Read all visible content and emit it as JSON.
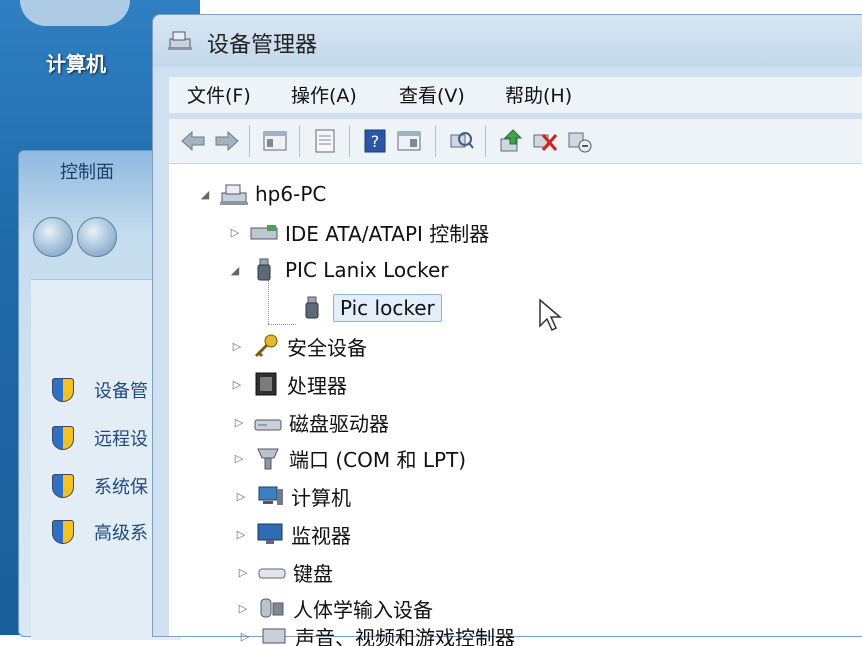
{
  "desktop": {
    "computer_label": "计算机",
    "control_panel": {
      "home_label": "控制面",
      "links": [
        "设备管",
        "远程设",
        "系统保",
        "高级系"
      ]
    }
  },
  "window": {
    "title": "设备管理器",
    "menu": [
      "文件(F)",
      "操作(A)",
      "查看(V)",
      "帮助(H)"
    ],
    "toolbar_icons": [
      "back-icon",
      "forward-icon",
      "console-tree-icon",
      "properties-icon",
      "help-icon",
      "action-pane-icon",
      "scan-hardware-icon",
      "update-driver-icon",
      "disable-device-icon",
      "uninstall-icon"
    ],
    "tree": {
      "root": "hp6-PC",
      "items": [
        {
          "label": "IDE ATA/ATAPI 控制器",
          "icon": "ide-controller-icon",
          "expanded": false
        },
        {
          "label": "PIC Lanix Locker",
          "icon": "usb-device-icon",
          "expanded": true,
          "children": [
            {
              "label": "Pic locker",
              "icon": "usb-device-icon",
              "selected": true
            }
          ]
        },
        {
          "label": "安全设备",
          "icon": "key-icon",
          "expanded": false
        },
        {
          "label": "处理器",
          "icon": "cpu-icon",
          "expanded": false
        },
        {
          "label": "磁盘驱动器",
          "icon": "disk-drive-icon",
          "expanded": false
        },
        {
          "label": "端口 (COM 和 LPT)",
          "icon": "port-icon",
          "expanded": false
        },
        {
          "label": "计算机",
          "icon": "computer-icon",
          "expanded": false
        },
        {
          "label": "监视器",
          "icon": "monitor-icon",
          "expanded": false
        },
        {
          "label": "键盘",
          "icon": "keyboard-icon",
          "expanded": false
        },
        {
          "label": "人体学输入设备",
          "icon": "hid-icon",
          "expanded": false
        },
        {
          "label": "声音、视频和游戏控制器",
          "icon": "sound-icon",
          "expanded": false
        }
      ]
    }
  }
}
